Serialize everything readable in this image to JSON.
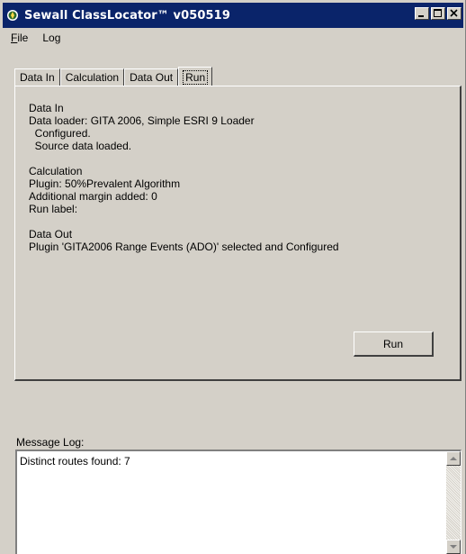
{
  "window": {
    "title": "Sewall ClassLocator™ v050519",
    "title_bg": "#0a246a",
    "face_color": "#d4d0c8"
  },
  "menu": {
    "items": [
      {
        "label": "File",
        "mnemonic": "F",
        "rest": "ile"
      },
      {
        "label": "Log"
      }
    ]
  },
  "tabs": [
    {
      "label": "Data In"
    },
    {
      "label": "Calculation"
    },
    {
      "label": "Data Out"
    },
    {
      "label": "Run",
      "active": true
    }
  ],
  "run_tab": {
    "summary_lines": [
      "Data In",
      "Data loader: GITA 2006, Simple ESRI 9 Loader",
      "  Configured.",
      "  Source data loaded.",
      "",
      "Calculation",
      "Plugin: 50%Prevalent Algorithm",
      "Additional margin added: 0",
      "Run label:",
      "",
      "Data Out",
      "Plugin 'GITA2006 Range Events (ADO)' selected and Configured"
    ],
    "run_button_label": "Run"
  },
  "message_log": {
    "label": "Message Log:",
    "text": "Distinct routes found: 7"
  },
  "icons": {
    "app": "app-icon",
    "minimize": "minimize-icon",
    "maximize": "maximize-icon",
    "close": "close-icon",
    "scroll_up": "arrow-up-icon",
    "scroll_down": "arrow-down-icon"
  }
}
